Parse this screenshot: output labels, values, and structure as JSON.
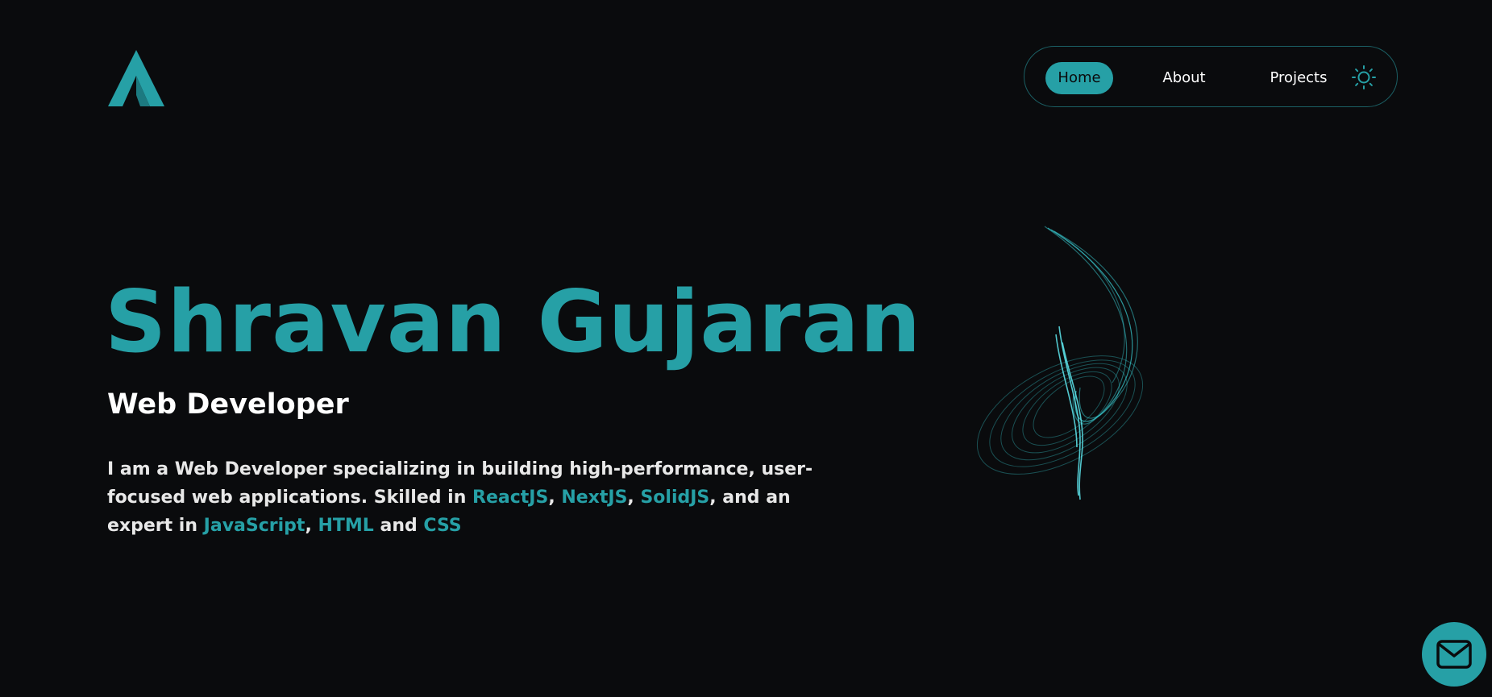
{
  "brand": {
    "logo_icon": "a-letter-logo-icon",
    "accent_color": "#26a0a6",
    "background_color": "#0a0b0d"
  },
  "nav": {
    "items": [
      {
        "label": "Home",
        "active": true
      },
      {
        "label": "About",
        "active": false
      },
      {
        "label": "Projects",
        "active": false
      }
    ],
    "theme_toggle_icon": "sun-icon"
  },
  "hero": {
    "name": "Shravan Gujaran",
    "role": "Web Developer",
    "bio": {
      "part1": "I am a Web Developer specializing in building high-performance, user-focused web applications. Skilled in ",
      "skill1": "ReactJS",
      "sep1": ", ",
      "skill2": "NextJS",
      "sep2": ", ",
      "skill3": "SolidJS",
      "part2": ", and an expert in ",
      "skill4": "JavaScript",
      "sep3": ", ",
      "skill5": "HTML",
      "part3": " and ",
      "skill6": "CSS"
    },
    "illustration_icon": "swirl-graphic"
  },
  "contact": {
    "button_icon": "mail-icon"
  }
}
